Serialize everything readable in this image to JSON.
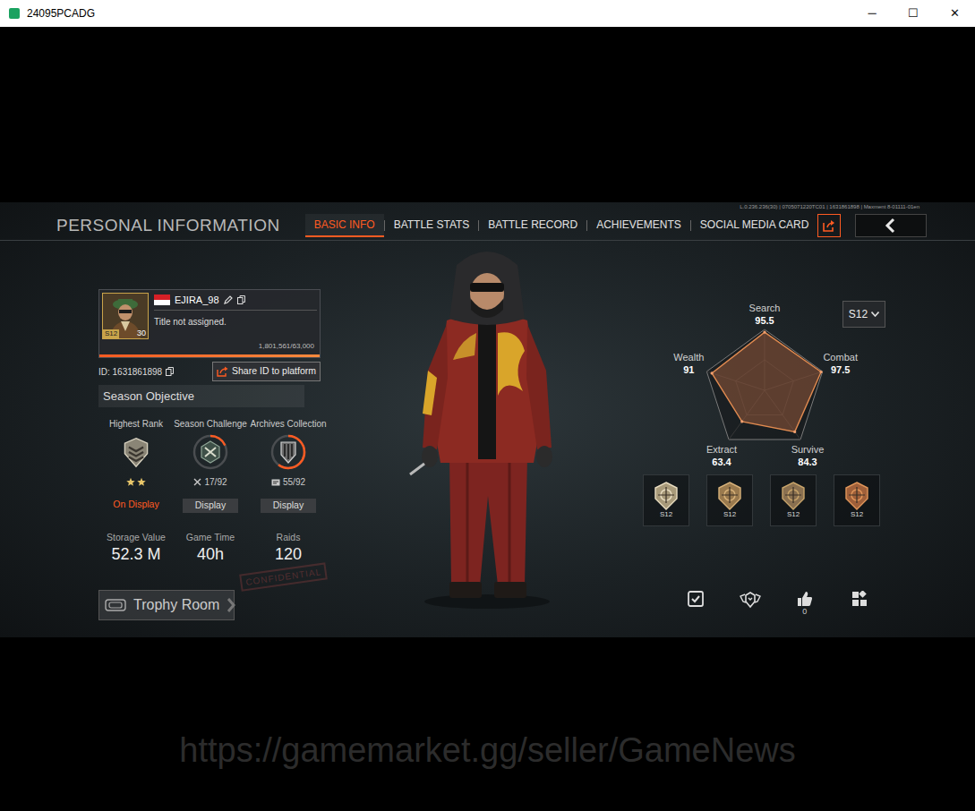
{
  "window": {
    "title": "24095PCADG",
    "controls": [
      "─",
      "☐",
      "✕"
    ]
  },
  "build_info": "L.0.236.236(30) | 0705071220TC01 | 1631861898 | Maxment 8-01111-01en",
  "header": {
    "title": "PERSONAL INFORMATION"
  },
  "tabs": [
    {
      "label": "BASIC INFO",
      "selected": true
    },
    {
      "label": "BATTLE STATS",
      "selected": false
    },
    {
      "label": "BATTLE RECORD",
      "selected": false
    },
    {
      "label": "ACHIEVEMENTS",
      "selected": false
    },
    {
      "label": "SOCIAL MEDIA CARD",
      "selected": false
    }
  ],
  "profile": {
    "avatar_season": "S12",
    "level": "30",
    "name": "EJIRA_98",
    "title": "Title not assigned.",
    "progress": "1,801,561/63,000",
    "id": "ID: 1631861898",
    "share_button": "Share ID to platform"
  },
  "season_objective": {
    "title": "Season Objective",
    "items": [
      {
        "label": "Highest Rank",
        "kind": "rank",
        "stars": 2,
        "button": "On Display",
        "selected": true
      },
      {
        "label": "Season Challenge",
        "kind": "challenge",
        "count": "17/92",
        "level": 0.18,
        "button": "Display",
        "selected": false
      },
      {
        "label": "Archives Collection",
        "kind": "archive",
        "count": "55/92",
        "level": 0.6,
        "button": "Display",
        "selected": false
      }
    ]
  },
  "stats": [
    {
      "label": "Storage Value",
      "value": "52.3 M"
    },
    {
      "label": "Game Time",
      "value": "40h"
    },
    {
      "label": "Raids",
      "value": "120"
    }
  ],
  "stamp": "CONFIDENTIAL",
  "trophy_room": "Trophy Room",
  "season_select": "S12",
  "radar": {
    "axes": [
      {
        "label": "Search",
        "reading": "95.5"
      },
      {
        "label": "Combat",
        "reading": "97.5"
      },
      {
        "label": "Survive",
        "reading": "84.3"
      },
      {
        "label": "Extract",
        "reading": "63.4"
      },
      {
        "label": "Wealth",
        "reading": "91"
      }
    ],
    "values": [
      95.5,
      97.5,
      84.3,
      63.4,
      91
    ]
  },
  "badges": [
    {
      "label": "S12"
    },
    {
      "label": "S12"
    },
    {
      "label": "S12"
    },
    {
      "label": "S12"
    }
  ],
  "likes": "0",
  "watermark": "https://gamemarket.gg/seller/GameNews"
}
